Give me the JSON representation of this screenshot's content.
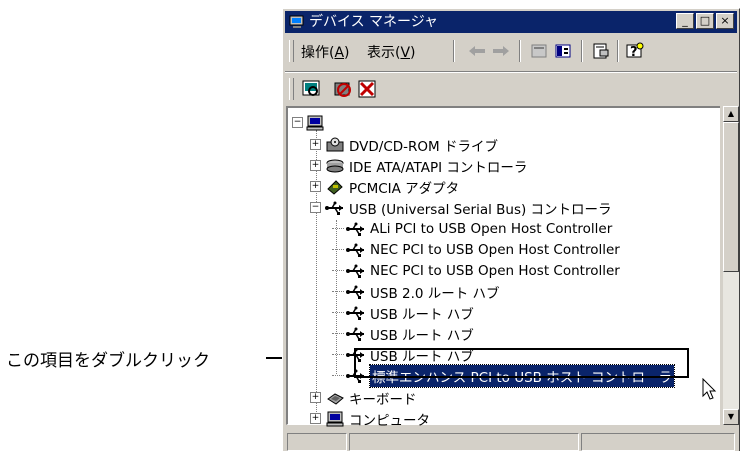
{
  "annotation": {
    "text": "この項目をダブルクリック"
  },
  "window": {
    "title": "デバイス マネージャ",
    "buttons": {
      "minimize": "_",
      "maximize": "□",
      "close": "×"
    }
  },
  "menu": {
    "action": {
      "label": "操作(",
      "key": "A",
      "end": ")"
    },
    "view": {
      "label": "表示(",
      "key": "V",
      "end": ")"
    }
  },
  "toolbar": {
    "icons": [
      "back-arrow-icon",
      "forward-arrow-icon",
      "properties-icon",
      "view-icon",
      "device-props-icon",
      "help-icon"
    ]
  },
  "toolbar2": {
    "icons": [
      "scan-hardware-icon",
      "disable-device-icon",
      "uninstall-device-icon"
    ]
  },
  "tree": {
    "root_expander": "−",
    "items": [
      {
        "label": "DVD/CD-ROM ドライブ",
        "expander": "+",
        "icon": "cdrom-icon"
      },
      {
        "label": "IDE ATA/ATAPI コントローラ",
        "expander": "+",
        "icon": "disk-controller-icon"
      },
      {
        "label": "PCMCIA アダプタ",
        "expander": "+",
        "icon": "pcmcia-icon"
      },
      {
        "label": "USB (Universal Serial Bus) コントローラ",
        "expander": "−",
        "icon": "usb-icon"
      }
    ],
    "usb_children": [
      "ALi PCI to USB Open Host Controller",
      "NEC PCI to USB Open Host Controller",
      "NEC PCI to USB Open Host Controller",
      "USB 2.0 ルート ハブ",
      "USB ルート ハブ",
      "USB ルート ハブ",
      "USB ルート ハブ"
    ],
    "selected": "標準エンハンス PCI to USB ホスト コントローラ",
    "after": [
      {
        "label": "キーボード",
        "expander": "+",
        "icon": "keyboard-icon"
      },
      {
        "label": "コンピュータ",
        "expander": "+",
        "icon": "computer-icon"
      }
    ]
  },
  "colors": {
    "titlebar": "#0a246a",
    "selection": "#0a246a",
    "face": "#d4d0c8"
  }
}
